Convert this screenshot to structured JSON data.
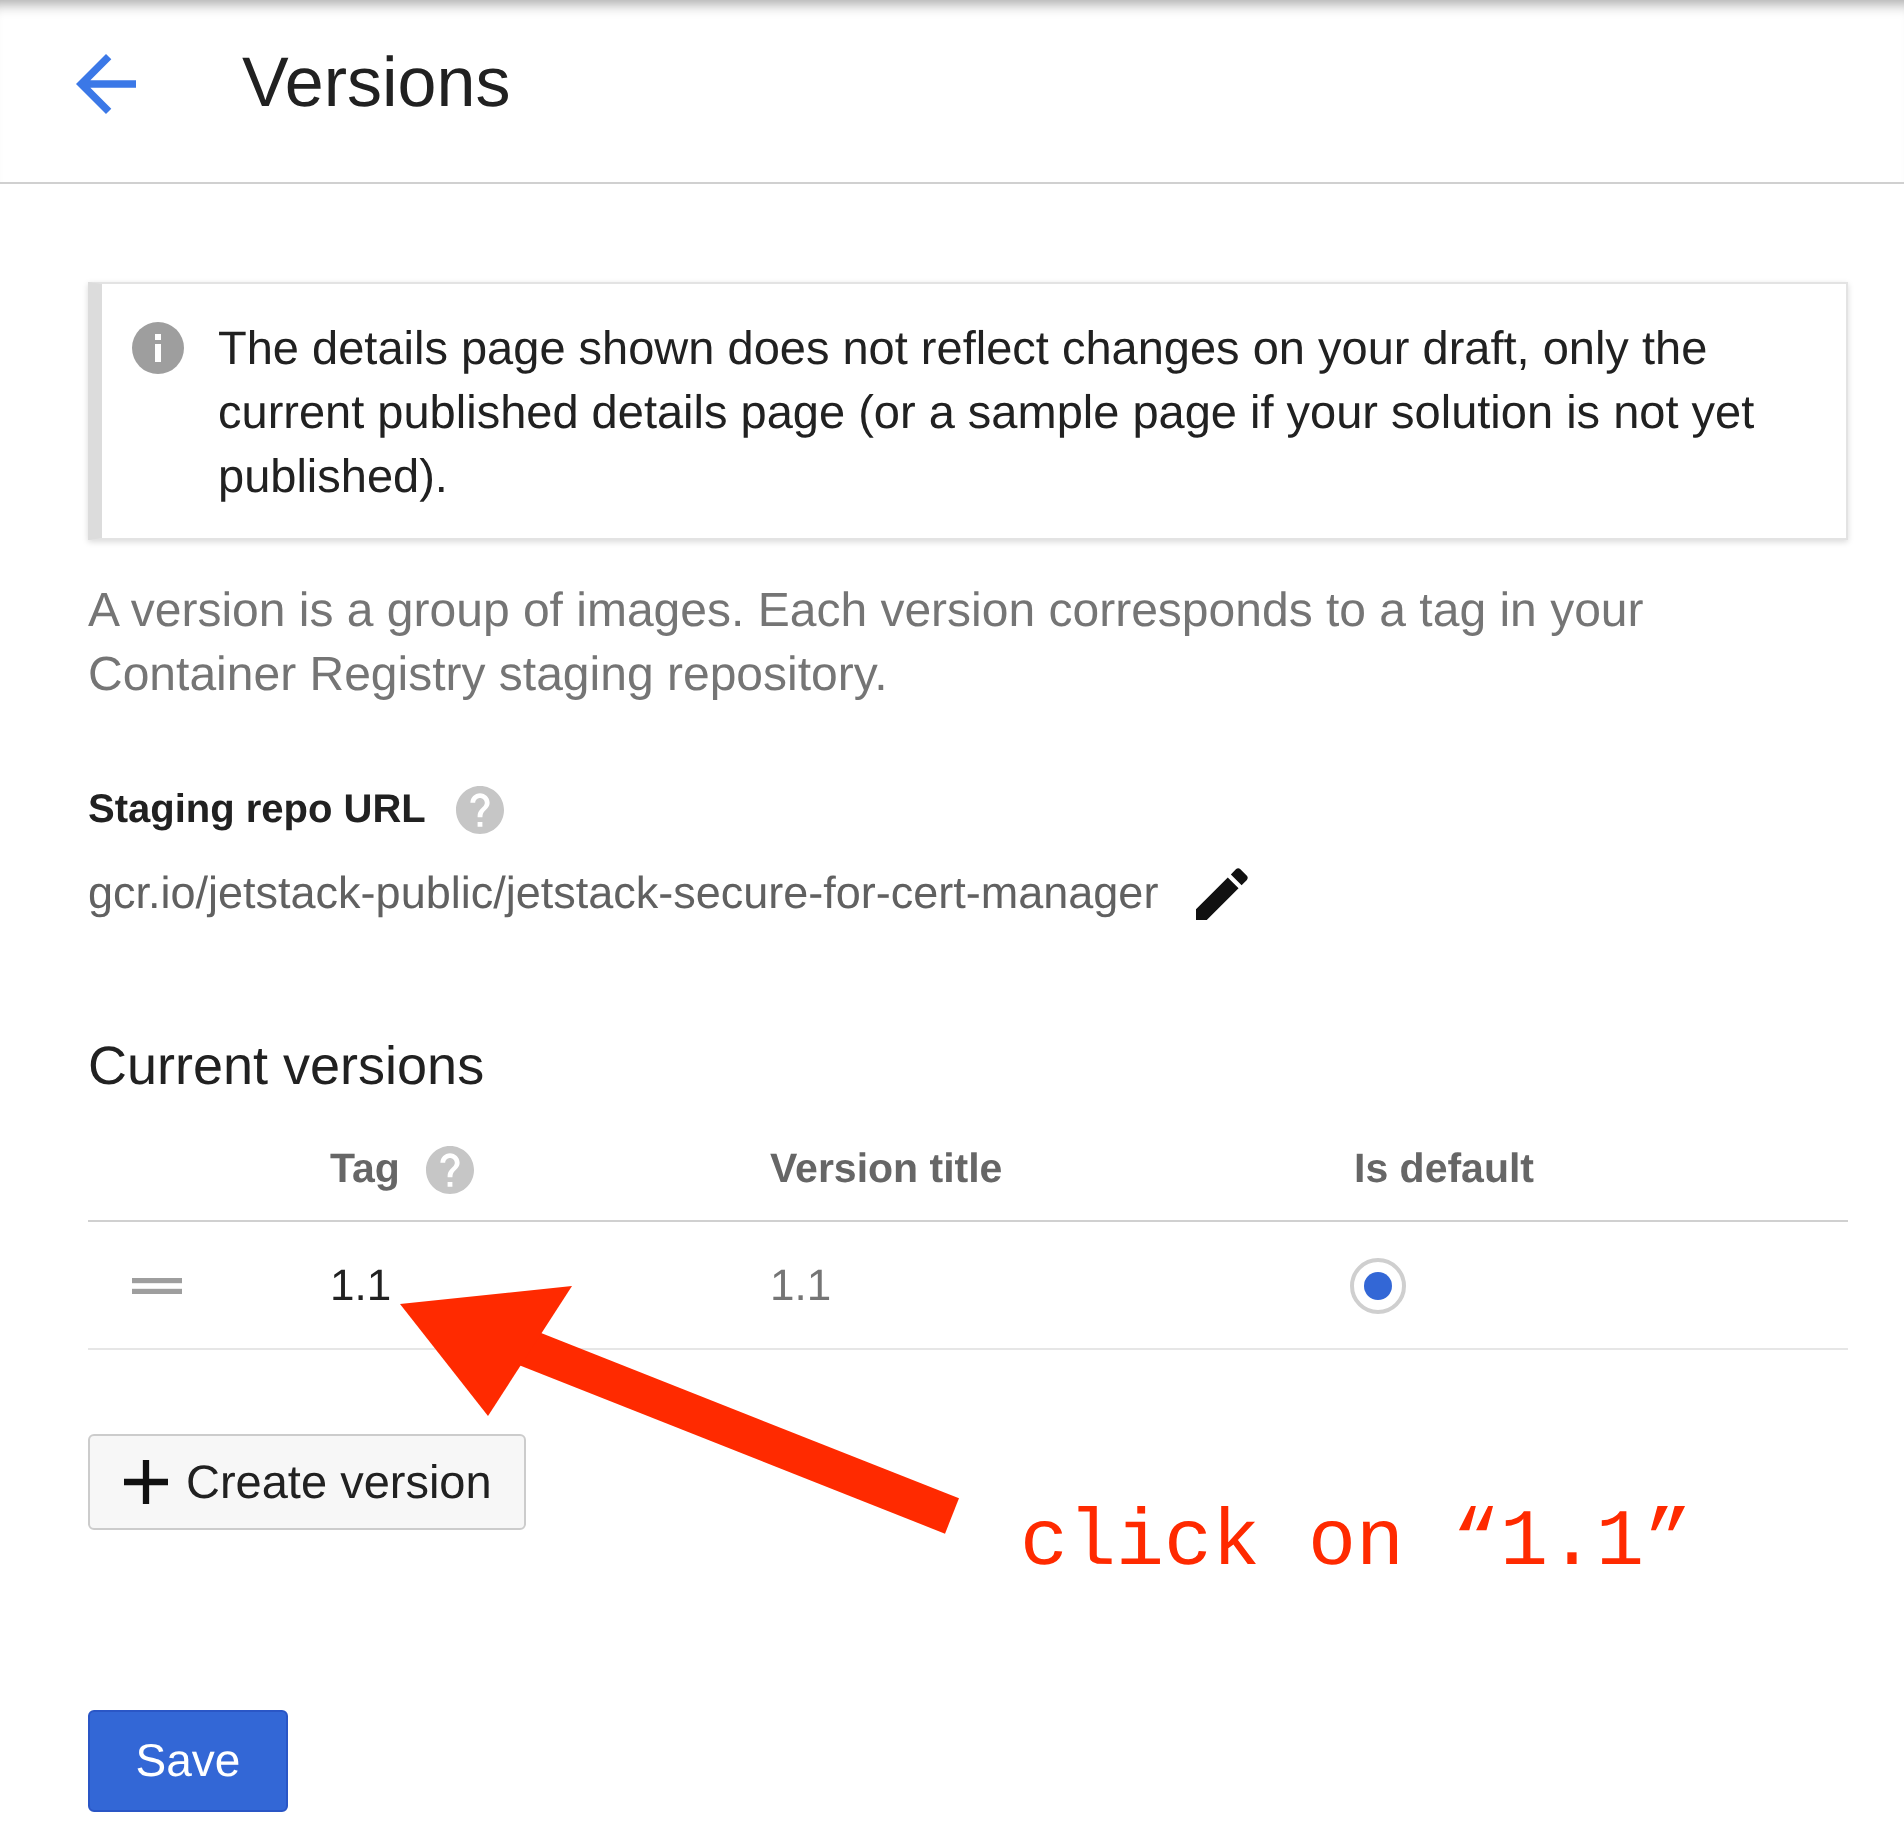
{
  "header": {
    "title": "Versions"
  },
  "notice": {
    "text": "The details page shown does not reflect changes on your draft, only the current published details page (or a sample page if your solution is not yet published)."
  },
  "description": "A version is a group of images. Each version corresponds to a tag in your Container Registry staging repository.",
  "staging_repo": {
    "label": "Staging repo URL",
    "help": true,
    "url": "gcr.io/jetstack-public/jetstack-secure-for-cert-manager",
    "editable": true
  },
  "current_versions": {
    "title": "Current versions",
    "columns": [
      {
        "label": "Tag",
        "help": true
      },
      {
        "label": "Version title",
        "help": false
      },
      {
        "label": "Is default",
        "help": false
      }
    ],
    "rows": [
      {
        "tag": "1.1",
        "version_title": "1.1",
        "is_default": true
      }
    ]
  },
  "create_button": {
    "label": "Create version"
  },
  "save_button": {
    "label": "Save"
  },
  "annotation": {
    "text": "click on “1.1”"
  }
}
